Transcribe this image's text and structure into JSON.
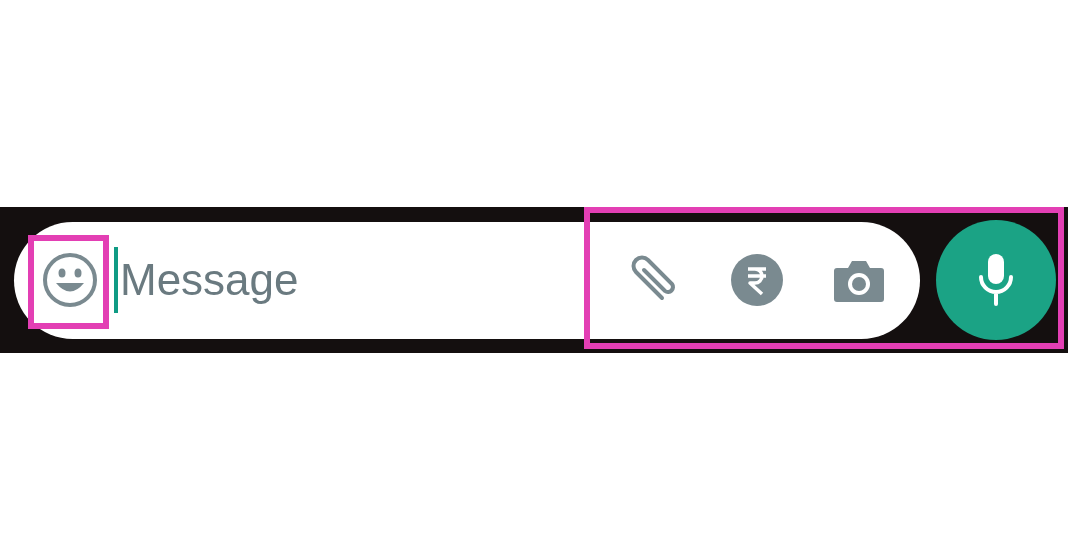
{
  "message_bar": {
    "placeholder": "Message",
    "focused": true
  }
}
